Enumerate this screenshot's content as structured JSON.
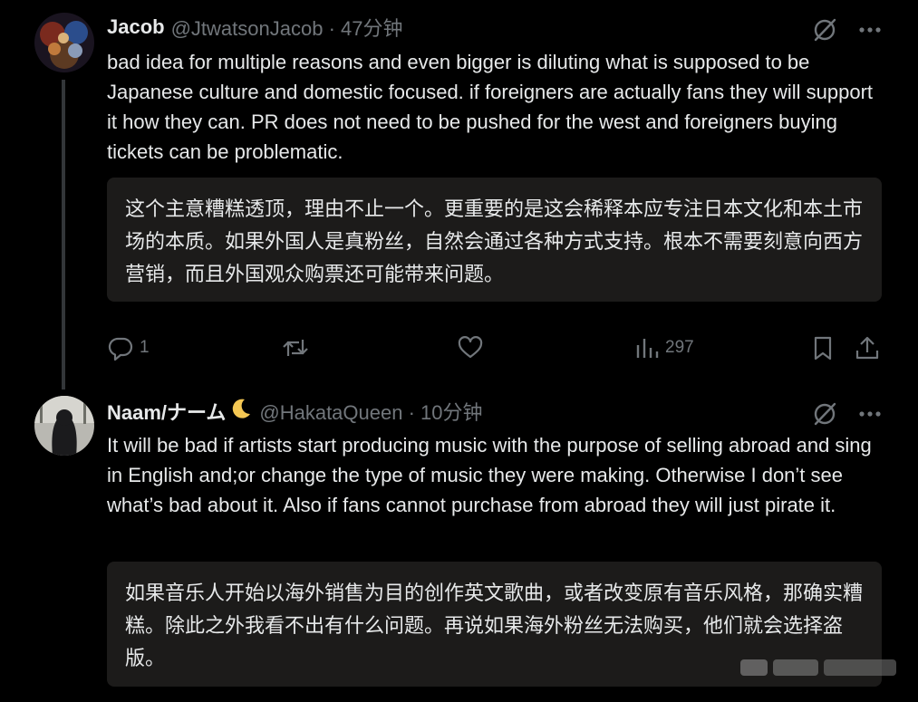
{
  "posts": [
    {
      "name": "Jacob",
      "handle": "@JtwatsonJacob · 47分钟",
      "text": "bad idea for multiple reasons and even bigger is diluting what is supposed to be Japanese culture and domestic focused. if foreigners are actually fans they will support it how they can. PR does not need to be pushed for the west and foreigners buying tickets can be problematic.",
      "translation": "这个主意糟糕透顶，理由不止一个。更重要的是这会稀释本应专注日本文化和本土市场的本质。如果外国人是真粉丝，自然会通过各种方式支持。根本不需要刻意向西方营销，而且外国观众购票还可能带来问题。",
      "replies": "1",
      "views": "297"
    },
    {
      "name": "Naam/ナーム",
      "handle": "@HakataQueen · 10分钟",
      "text": "It will be bad if artists start producing music with the purpose of selling abroad and sing in English and;or change the type of music they were making. Otherwise I don’t see what’s bad about it. Also if fans cannot purchase from abroad they will just pirate it.",
      "translation": "如果音乐人开始以海外销售为目的创作英文歌曲，或者改变原有音乐风格，那确实糟糕。除此之外我看不出有什么问题。再说如果海外粉丝无法购买，他们就会选择盗版。"
    }
  ],
  "icons": {
    "grok": "slashed-circle-icon",
    "more": "more-dots-icon",
    "reply": "reply-icon",
    "repost": "repost-icon",
    "like": "like-icon",
    "views": "views-icon",
    "bookmark": "bookmark-icon",
    "share": "share-icon",
    "moon": "crescent-moon-icon"
  },
  "colors": {
    "background": "#000000",
    "text": "#e7e9ea",
    "muted": "#71767b",
    "translation_bg": "#1c1b1a",
    "thread_line": "#333639"
  }
}
